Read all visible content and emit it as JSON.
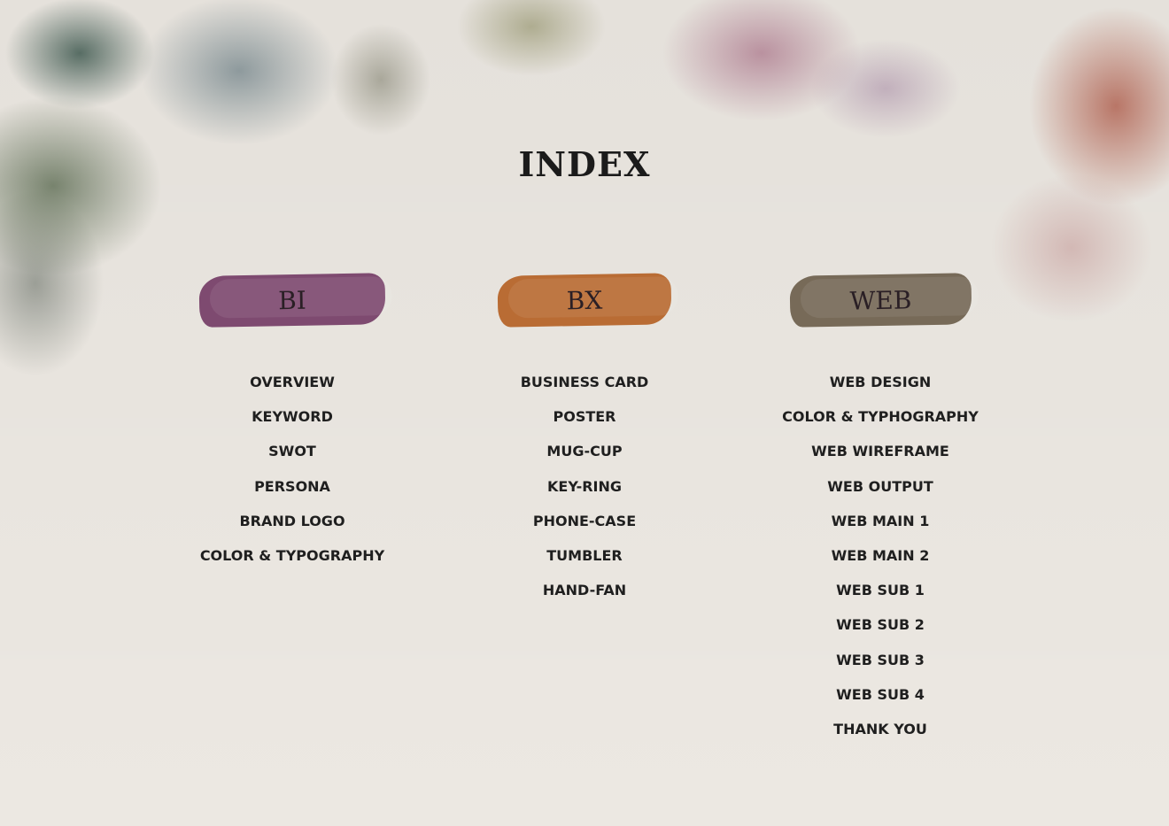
{
  "title": "INDEX",
  "columns": [
    {
      "heading": "BI",
      "color": "#7e4a70",
      "items": [
        "OVERVIEW",
        "KEYWORD",
        "SWOT",
        "PERSONA",
        "BRAND LOGO",
        "COLOR & TYPOGRAPHY"
      ]
    },
    {
      "heading": "BX",
      "color": "#b96c34",
      "items": [
        "BUSINESS CARD",
        "POSTER",
        "MUG-CUP",
        "KEY-RING",
        "PHONE-CASE",
        "TUMBLER",
        "HAND-FAN"
      ]
    },
    {
      "heading": "WEB",
      "color": "#776a58",
      "items": [
        "WEB DESIGN",
        "COLOR & TYPHOGRAPHY",
        "WEB WIREFRAME",
        "WEB OUTPUT",
        "WEB MAIN 1",
        "WEB MAIN 2",
        "WEB SUB 1",
        "WEB SUB 2",
        "WEB SUB 3",
        "WEB SUB 4",
        "THANK YOU"
      ]
    }
  ]
}
